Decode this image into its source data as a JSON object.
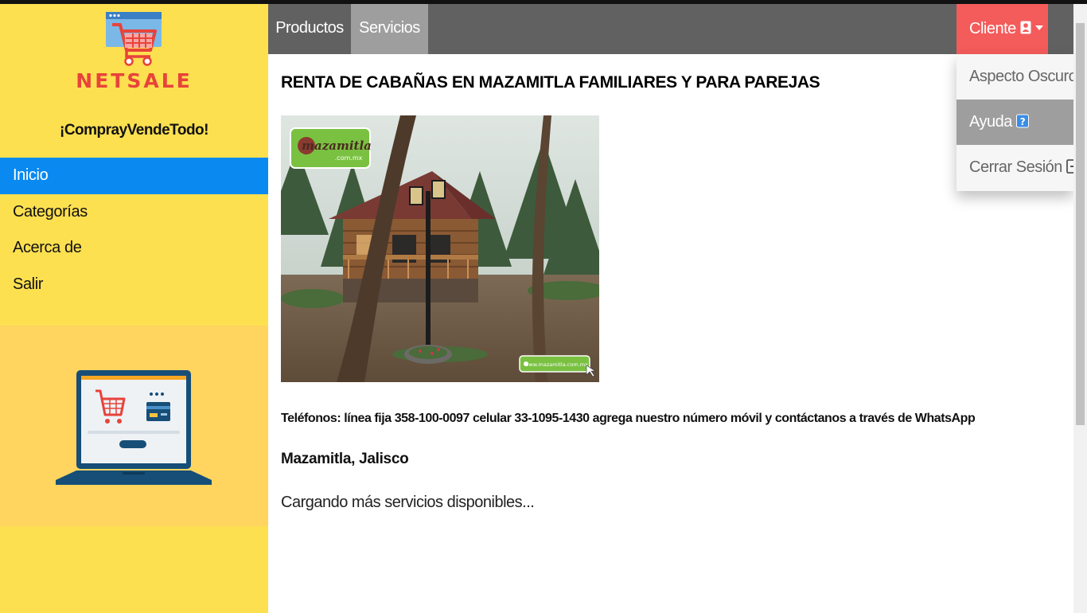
{
  "brand": {
    "name": "NETSALE",
    "slogan": "¡ComprayVendeTodo!"
  },
  "sidebar": {
    "items": [
      {
        "label": "Inicio",
        "active": true
      },
      {
        "label": "Categorías"
      },
      {
        "label": "Acerca de"
      },
      {
        "label": "Salir"
      }
    ]
  },
  "topbar": {
    "tabs": [
      {
        "label": "Productos"
      },
      {
        "label": "Servicios",
        "active": true
      }
    ],
    "client_label": "Cliente"
  },
  "dropdown": {
    "items": [
      {
        "label": "Aspecto Oscuro",
        "icon": "moon-icon"
      },
      {
        "label": "Ayuda",
        "icon": "help-icon",
        "active": true
      },
      {
        "label": "Cerrar Sesión",
        "icon": "logout-icon"
      }
    ]
  },
  "listing": {
    "title": "RENTA DE CABAÑAS EN MAZAMITLA FAMILIARES Y PARA PAREJAS",
    "image": {
      "badge": "mazamitla",
      "badge_sub": ".com.mx",
      "watermark": "www.mazamitla.com.mx"
    },
    "phones": "Teléfonos: línea fija 358-100-0097 celular 33-1095-1430 agrega nuestro número móvil y contáctanos a través de WhatsApp",
    "location": "Mazamitla, Jalisco"
  },
  "status": {
    "loading": "Cargando más servicios disponibles..."
  },
  "colors": {
    "sidebar": "#fde050",
    "active_nav": "#0a8af0",
    "topbar": "#616161",
    "client_button": "#f45b5b",
    "brand_text": "#e8433a"
  }
}
